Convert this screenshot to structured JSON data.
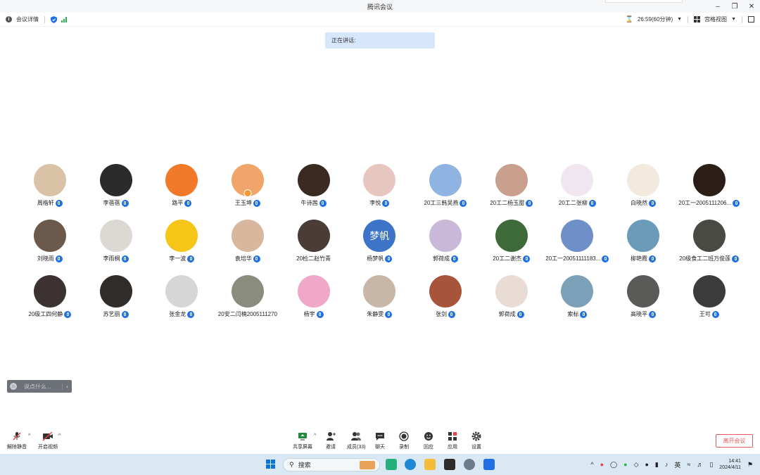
{
  "window": {
    "title": "腾讯会议"
  },
  "infobar": {
    "meeting_details": "会议详情",
    "timer": "26:59(60分钟)",
    "view_mode": "宫格视图"
  },
  "speaking": {
    "label": "正在讲话:"
  },
  "participants": [
    {
      "name": "周楷轩",
      "color": "#d9c2a5"
    },
    {
      "name": "李蓓蓓",
      "color": "#2b2b2b"
    },
    {
      "name": "路平",
      "color": "#f07a2a"
    },
    {
      "name": "王玉坤",
      "color": "#f2a56b",
      "host": true
    },
    {
      "name": "牛诗茜",
      "color": "#3a2a22"
    },
    {
      "name": "李悦",
      "color": "#e8c6c0"
    },
    {
      "name": "20工三韩吴燕",
      "color": "#8fb3e3"
    },
    {
      "name": "20工二杨玉甜",
      "color": "#c9a08d"
    },
    {
      "name": "20工二张柳",
      "color": "#efe6f0"
    },
    {
      "name": "白晓然",
      "color": "#f2e9df"
    },
    {
      "name": "20工一2005111206...",
      "color": "#2a1e17"
    },
    {
      "name": "刘晓雨",
      "color": "#6b5a4c"
    },
    {
      "name": "李雨桐",
      "color": "#dcd8d3"
    },
    {
      "name": "李一波",
      "color": "#f5c518"
    },
    {
      "name": "袁培华",
      "color": "#d8b79e"
    },
    {
      "name": "20检二赵竹青",
      "color": "#4a3d38",
      "no_mic": true
    },
    {
      "name": "杨梦帆",
      "color": "#3d74c7",
      "initials": "梦帆"
    },
    {
      "name": "郭荷成",
      "color": "#c9b8d8"
    },
    {
      "name": "20工二谢杰",
      "color": "#3e6a3a"
    },
    {
      "name": "20工一20051111183...",
      "color": "#6e8fc7"
    },
    {
      "name": "柳艳霞",
      "color": "#6b9bb8"
    },
    {
      "name": "20级食工二班万俊莲",
      "color": "#4a4a44"
    },
    {
      "name": "20级工四何静",
      "color": "#3b3231"
    },
    {
      "name": "苏艺丽",
      "color": "#2f2c2a"
    },
    {
      "name": "张金龙",
      "color": "#d6d6d6"
    },
    {
      "name": "20安二闫楠2005111270",
      "color": "#8a8c7e",
      "no_mic": true
    },
    {
      "name": "杨宇",
      "color": "#f0a8c9"
    },
    {
      "name": "朱静雯",
      "color": "#c8b7a6"
    },
    {
      "name": "张剑",
      "color": "#a7553a"
    },
    {
      "name": "郭荷成",
      "color": "#e8dcd5"
    },
    {
      "name": "索标",
      "color": "#7ba0b8"
    },
    {
      "name": "高晓平",
      "color": "#5a5a58"
    },
    {
      "name": "王可",
      "color": "#3c3c3c"
    }
  ],
  "chat": {
    "placeholder": "说点什么..."
  },
  "toolbar": {
    "unmute": "解除静音",
    "start_video": "开启视频",
    "share_screen": "共享屏幕",
    "invite": "邀请",
    "members": "成员(33)",
    "chat": "聊天",
    "record": "录制",
    "reaction": "回应",
    "apps": "应用",
    "settings": "设置",
    "leave": "离开会议"
  },
  "taskbar": {
    "search": "搜索",
    "ime": "英",
    "time": "14:41",
    "date": "2024/4/11"
  }
}
